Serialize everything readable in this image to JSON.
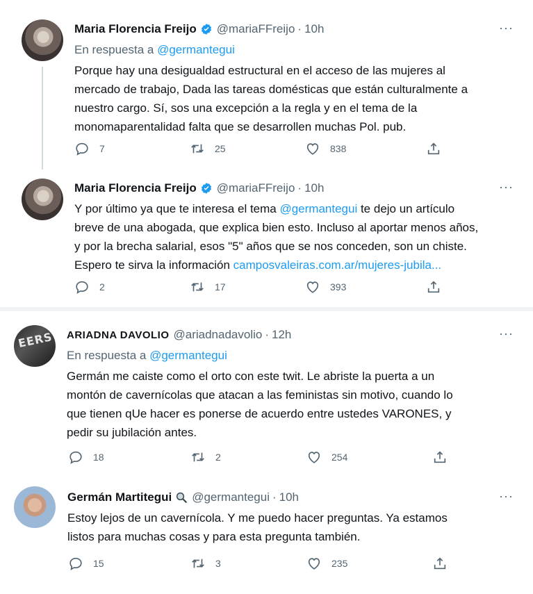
{
  "tweets": [
    {
      "name": "Maria Florencia Freijo",
      "handle": "@mariaFFreijo",
      "time": "10h",
      "verified": true,
      "reply_prefix": "En respuesta a",
      "reply_to": "@germantegui",
      "lines": [
        "Porque hay una desigualdad estructural en el acceso de las mujeres al",
        "mercado de trabajo, Dada las tareas domésticas que están culturalmente a",
        "nuestro cargo. Sí, sos una excepción a la regla y en el tema de la",
        "monomaparentalidad falta que se desarrollen muchas Pol. pub."
      ],
      "replies": "7",
      "retweets": "25",
      "likes": "838"
    },
    {
      "name": "Maria Florencia Freijo",
      "handle": "@mariaFFreijo",
      "time": "10h",
      "verified": true,
      "line1_pre": "Y por último ya que te interesa el tema ",
      "line1_mention": "@germantegui",
      "line1_post": " te dejo un artículo",
      "line2": "breve de una abogada, que explica bien esto. Incluso al aportar menos años,",
      "line3": "y por la brecha salarial, esos \"5\" años que se nos conceden, son un chiste.",
      "line4_pre": "Espero te sirva la información ",
      "line4_link": "camposvaleiras.com.ar/mujeres-jubila...",
      "replies": "2",
      "retweets": "17",
      "likes": "393"
    },
    {
      "name": "ARIADNA DAVOLIO",
      "handle": "@ariadnadavolio",
      "time": "12h",
      "avatar_text": "EERS",
      "reply_prefix": "En respuesta a",
      "reply_to": "@germantegui",
      "lines": [
        "Germán me caiste como el orto con este twit. Le abriste la puerta a un",
        "montón de cavernícolas que atacan a las feministas sin motivo, cuando lo",
        "que tienen qUe hacer es ponerse de acuerdo entre ustedes VARONES, y",
        "pedir su jubilación antes."
      ],
      "replies": "18",
      "retweets": "2",
      "likes": "254"
    },
    {
      "name": "Germán Martitegui",
      "handle": "@germantegui",
      "time": "10h",
      "badge_icon": "magnifier-icon",
      "lines": [
        "Estoy lejos de un cavernícola. Y me puedo hacer preguntas. Ya estamos",
        "listos para muchas cosas y para esta pregunta también."
      ],
      "replies": "15",
      "retweets": "3",
      "likes": "235"
    }
  ],
  "ui": {
    "more": "···",
    "dot": "·"
  },
  "colors": {
    "link": "#1d9bf0",
    "secondary": "#536471",
    "verified": "#1d9bf0"
  }
}
